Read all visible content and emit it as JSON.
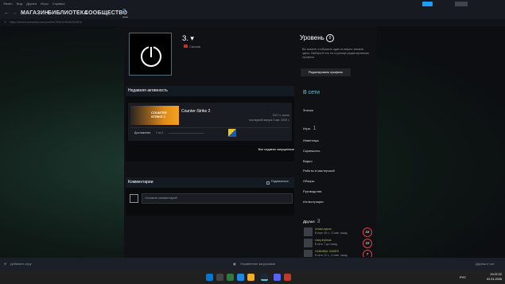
{
  "menubar": {
    "items": [
      "Steam",
      "Вид",
      "Друзья",
      "Игры",
      "Справка"
    ]
  },
  "nav": {
    "store": "МАГАЗИН",
    "library": "БИБЛИОТЕКА",
    "community": "СООБЩЕСТВО",
    "user": "З."
  },
  "urlbar": {
    "url": "https://steamcommunity.com/profiles/76561199481552803/"
  },
  "profile": {
    "name": "З. ▾",
    "country": "Canada",
    "level_label": "Уровень",
    "level": "0",
    "level_note": "Вы можете отобразить один из ваших значков здесь. Выберите его на странице редактирования профиля",
    "edit_button": "Редактировать профиль"
  },
  "activity": {
    "header": "Недавняя активность",
    "game": "Counter-Strike 2",
    "banner_text": "COUNTER STRIKE 2",
    "hours": "1107 ч. всего",
    "last_run": "последний запуск 3 авг. 2025 г.",
    "ach_label": "Достижения",
    "ach_count": "1 из 1",
    "recent_link": "Все недавно запущенные"
  },
  "comments": {
    "header": "Комментарии",
    "subscribe": "Подписаться",
    "placeholder": "Оставьте комментарий"
  },
  "sidebar": {
    "status": "В сети",
    "items": [
      {
        "label": "Значки",
        "count": ""
      },
      {
        "label": "Игры",
        "count": "1"
      },
      {
        "label": "Инвентарь",
        "count": ""
      },
      {
        "label": "Скриншоты",
        "count": ""
      },
      {
        "label": "Видео",
        "count": ""
      },
      {
        "label": "Работы в мастерской",
        "count": ""
      },
      {
        "label": "Обзоры",
        "count": ""
      },
      {
        "label": "Руководства",
        "count": ""
      },
      {
        "label": "Иллюстрации",
        "count": ""
      }
    ],
    "friends_label": "Друзья",
    "friends_count": "3",
    "friends": [
      {
        "name": "UrbanLegend",
        "status": "В игре: 45 ч., 12 мин. назад",
        "level": "22"
      },
      {
        "name": "shiny.thyfreak",
        "status": "В сети: 7 дн. назад",
        "level": "22"
      },
      {
        "name": "HANNIBAL GAMES",
        "status": "В сети: 20 ч., 12 мин. назад",
        "level": "7"
      }
    ]
  },
  "bottom": {
    "add_game": "Добавить игру",
    "downloads": "Управление загрузками",
    "friends_chat": "Друзья и чат"
  },
  "taskbar": {
    "time": "19:22:22",
    "date": "02.01.2026",
    "lang": "РУС"
  },
  "colors": {
    "accent": "#57cbde",
    "bg": "#171d25"
  }
}
